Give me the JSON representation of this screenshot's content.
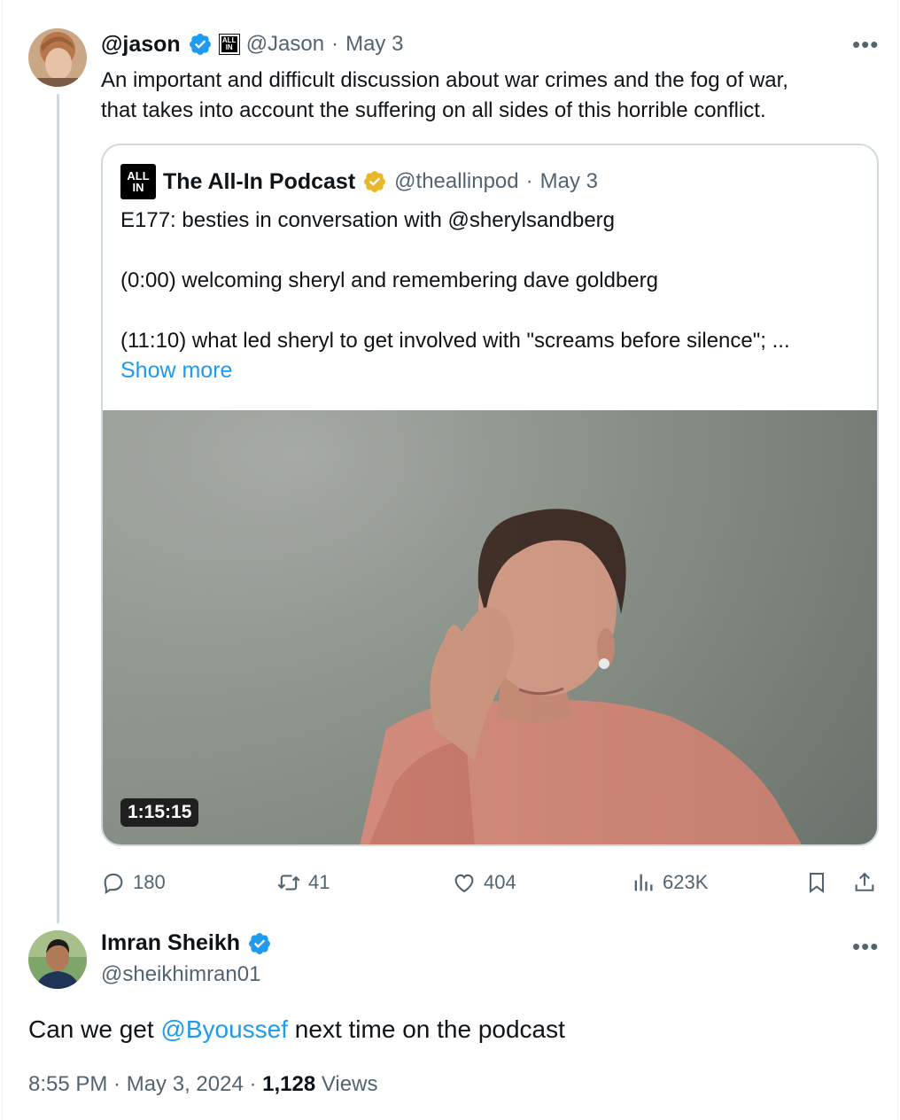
{
  "tweet": {
    "display_name": "@jason",
    "affiliate_badge": "ALL IN",
    "handle": "@Jason",
    "date": "May 3",
    "text_line1": "An important and difficult  discussion about war crimes and the fog of war,",
    "text_line2": "that takes into account the suffering on all sides of this horrible conflict."
  },
  "quote": {
    "logo_text": "ALL IN",
    "name": "The All-In Podcast",
    "handle": "@theallinpod",
    "date": "May 3",
    "line1": "E177: besties in conversation with @sherylsandberg",
    "line2": "(0:00) welcoming sheryl and remembering dave goldberg",
    "line3": "(11:10) what led sheryl to get involved with \"screams before silence\"; ...",
    "show_more": "Show more",
    "video_duration": "1:15:15"
  },
  "actions": {
    "replies": "180",
    "reposts": "41",
    "likes": "404",
    "views": "623K"
  },
  "reply": {
    "name": "Imran Sheikh",
    "handle": "@sheikhimran01",
    "text_before": "Can we get ",
    "mention": "@Byoussef",
    "text_after": " next time on the podcast",
    "time": "8:55 PM · May 3, 2024 · ",
    "views_count": "1,128",
    "views_label": " Views"
  },
  "colors": {
    "verified_blue": "#1d9bf0",
    "verified_gold": "#e8b829",
    "link": "#1d9bf0",
    "muted": "#536471"
  },
  "icons": [
    "verified-badge-icon",
    "more-icon",
    "reply-icon",
    "repost-icon",
    "like-icon",
    "views-icon",
    "bookmark-icon",
    "share-icon"
  ]
}
